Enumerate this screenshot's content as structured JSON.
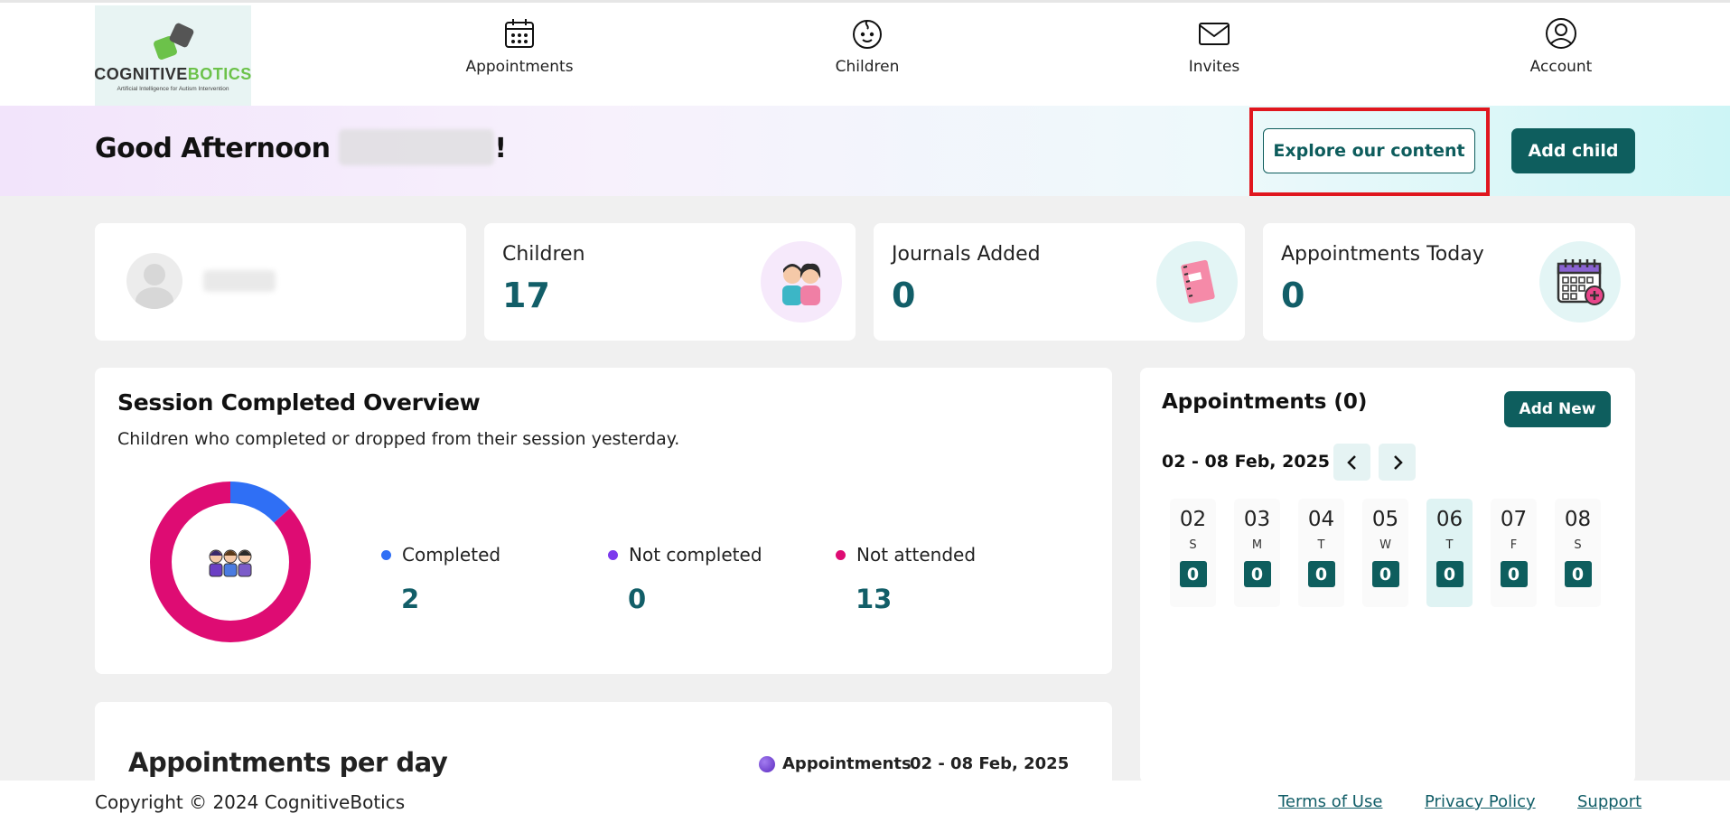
{
  "logo": {
    "brand_part1": "COGNITIVE",
    "brand_part2": "BOTICS",
    "tagline": "Artificial Intelligence for Autism Intervention"
  },
  "nav": {
    "items": [
      {
        "label": "Appointments",
        "icon": "calendar-icon"
      },
      {
        "label": "Children",
        "icon": "baby-face-icon"
      },
      {
        "label": "Invites",
        "icon": "envelope-icon"
      },
      {
        "label": "Account",
        "icon": "user-circle-icon"
      }
    ]
  },
  "greeting": {
    "prefix": "Good Afternoon ",
    "suffix": "!"
  },
  "actions": {
    "explore_label": "Explore our content",
    "add_child_label": "Add child"
  },
  "stats": {
    "children": {
      "title": "Children",
      "value": "17",
      "icon": "children-illustration-icon"
    },
    "journals": {
      "title": "Journals Added",
      "value": "0",
      "icon": "notebook-icon"
    },
    "appointments_today": {
      "title": "Appointments Today",
      "value": "0",
      "icon": "calendar-add-icon"
    }
  },
  "session": {
    "title": "Session Completed Overview",
    "subtitle": "Children who completed or dropped from their session yesterday.",
    "legend": [
      {
        "label": "Completed",
        "value": "2",
        "color": "#2f6ff5"
      },
      {
        "label": "Not completed",
        "value": "0",
        "color": "#7c3aed"
      },
      {
        "label": "Not attended",
        "value": "13",
        "color": "#de0c73"
      }
    ]
  },
  "chart_data": {
    "type": "pie",
    "categories": [
      "Completed",
      "Not completed",
      "Not attended"
    ],
    "values": [
      2,
      0,
      13
    ],
    "colors": [
      "#2f6ff5",
      "#7c3aed",
      "#de0c73"
    ],
    "title": "Session Completed Overview"
  },
  "appointments_panel": {
    "title": "Appointments (0)",
    "add_new_label": "Add New",
    "date_range": "02 - 08 Feb, 2025",
    "days": [
      {
        "date": "02",
        "weekday": "S",
        "count": "0",
        "selected": false
      },
      {
        "date": "03",
        "weekday": "M",
        "count": "0",
        "selected": false
      },
      {
        "date": "04",
        "weekday": "T",
        "count": "0",
        "selected": false
      },
      {
        "date": "05",
        "weekday": "W",
        "count": "0",
        "selected": false
      },
      {
        "date": "06",
        "weekday": "T",
        "count": "0",
        "selected": true
      },
      {
        "date": "07",
        "weekday": "F",
        "count": "0",
        "selected": false
      },
      {
        "date": "08",
        "weekday": "S",
        "count": "0",
        "selected": false
      }
    ]
  },
  "per_day": {
    "title": "Appointments per day",
    "legend_label": "Appointments",
    "date_range": "02 - 08 Feb, 2025"
  },
  "footer": {
    "copyright": "Copyright © 2024 CognitiveBotics",
    "terms": "Terms of Use",
    "privacy": "Privacy Policy",
    "support": "Support"
  }
}
